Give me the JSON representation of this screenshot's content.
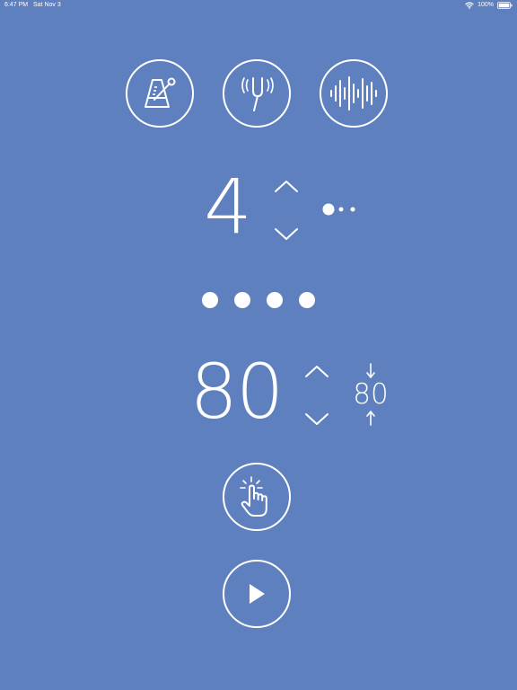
{
  "status_bar": {
    "time": "6:47 PM",
    "date": "Sat Nov 3",
    "battery": "100%",
    "icons": [
      "wifi-icon",
      "battery-icon"
    ]
  },
  "modes": [
    {
      "icon": "metronome-icon"
    },
    {
      "icon": "tuning-fork-icon"
    },
    {
      "icon": "sound-wave-icon"
    }
  ],
  "beats": {
    "value": "4",
    "increase_icon": "chevron-up-icon",
    "decrease_icon": "chevron-down-icon",
    "subdivision_icon": "subdivision-dots-icon"
  },
  "beat_indicator": {
    "count": 4
  },
  "tempo": {
    "value": "80",
    "reference_value": "80",
    "increase_icon": "chevron-up-icon",
    "decrease_icon": "chevron-down-icon"
  },
  "controls": {
    "tap_icon": "tap-hand-icon",
    "play_icon": "play-icon"
  },
  "colors": {
    "background": "#5f80bf",
    "foreground": "#ffffff"
  }
}
